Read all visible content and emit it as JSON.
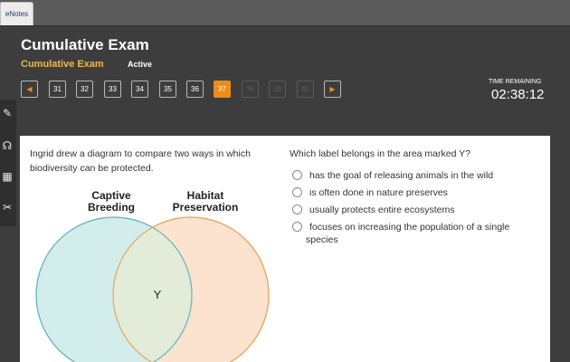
{
  "tab": {
    "label": "eNotes"
  },
  "header": {
    "title": "Cumulative Exam",
    "subtitle": "Cumulative Exam",
    "status": "Active"
  },
  "navigation": {
    "questions": [
      "31",
      "32",
      "33",
      "34",
      "35",
      "36",
      "37",
      "38",
      "39",
      "40"
    ],
    "current": "37"
  },
  "timer": {
    "label": "TIME REMAINING",
    "value": "02:38:12"
  },
  "question": {
    "prompt": "Ingrid drew a diagram to compare two ways in which biodiversity can be protected.",
    "stem": "Which label belongs in the area marked Y?",
    "options": [
      "has the goal of releasing animals in the wild",
      "is often done in nature preserves",
      "usually protects entire ecosystems",
      "focuses on increasing the population of a single species"
    ]
  },
  "venn": {
    "left_label_line1": "Captive",
    "left_label_line2": "Breeding",
    "right_label_line1": "Habitat",
    "right_label_line2": "Preservation",
    "overlap_label": "Y",
    "left_color": "#d3ecec",
    "right_color": "#fbe3cf",
    "left_stroke": "#6fb8be",
    "right_stroke": "#e9a661"
  },
  "colors": {
    "accent": "#f08c1a",
    "subtitle": "#f2b84b",
    "background": "#3d3d3d"
  }
}
